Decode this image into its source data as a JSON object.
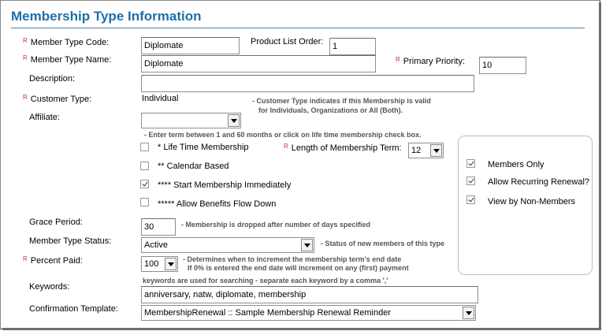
{
  "heading": "Membership Type Information",
  "required_mark": "R",
  "fields": {
    "member_type_code": {
      "label": "Member Type Code:",
      "value": "Diplomate"
    },
    "product_list_order": {
      "label": "Product List Order:",
      "value": "1"
    },
    "member_type_name": {
      "label": "Member Type Name:",
      "value": "Diplomate"
    },
    "primary_priority": {
      "label": "Primary Priority:",
      "value": "10"
    },
    "description": {
      "label": "Description:",
      "value": ""
    },
    "customer_type": {
      "label": "Customer Type:",
      "value": "Individual",
      "help_1": "- Customer Type indicates if this Membership is valid",
      "help_2": "for Individuals, Organizations or All (Both)."
    },
    "affiliate": {
      "label": "Affiliate:",
      "value": ""
    },
    "term_help": "- Enter term between 1 and 60 months or click on life time membership check box.",
    "life_time": {
      "label": "* Life Time Membership",
      "checked": false
    },
    "length_of_term": {
      "label": "Length of Membership Term:",
      "value": "12"
    },
    "calendar_based": {
      "label": "** Calendar Based",
      "checked": false
    },
    "start_immediately": {
      "label": "**** Start Membership Immediately",
      "checked": true
    },
    "benefits_flow_down": {
      "label": "***** Allow Benefits Flow Down",
      "checked": false
    },
    "grace_period": {
      "label": "Grace Period:",
      "value": "30",
      "help": "- Membership is dropped after number of days specified"
    },
    "member_type_status": {
      "label": "Member Type Status:",
      "value": "Active",
      "help": "- Status of new members of this type"
    },
    "percent_paid": {
      "label": "Percent Paid:",
      "value": "100",
      "help_1": "- Determines when to increment the membership term's end date",
      "help_2": "If 0% is entered the end date will increment on any (first) payment"
    },
    "keywords": {
      "label": "Keywords:",
      "help": "keywords are used for searching - separate each keyword by a comma ','",
      "value": "anniversary, natw, diplomate, membership"
    },
    "confirmation_template": {
      "label": "Confirmation Template:",
      "value": "MembershipRenewal :: Sample Membership Renewal Reminder"
    }
  },
  "options_panel": {
    "members_only": {
      "label": "Members Only",
      "checked": true
    },
    "allow_recurring_renewal": {
      "label": "Allow Recurring Renewal?",
      "checked": true
    },
    "view_by_non_members": {
      "label": "View by Non-Members",
      "checked": true
    }
  }
}
